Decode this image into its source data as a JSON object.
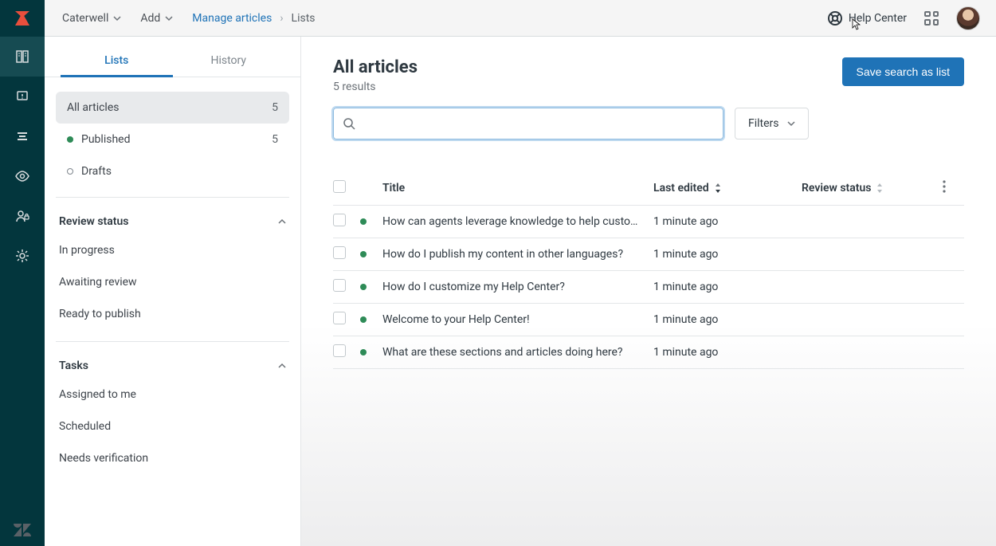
{
  "top": {
    "brand_dropdown": "Caterwell",
    "add": "Add",
    "breadcrumb_link": "Manage articles",
    "breadcrumb_current": "Lists",
    "help_center": "Help Center"
  },
  "sidebar": {
    "tabs": {
      "lists": "Lists",
      "history": "History"
    },
    "items": [
      {
        "label": "All articles",
        "count": "5"
      },
      {
        "label": "Published",
        "count": "5"
      },
      {
        "label": "Drafts",
        "count": ""
      }
    ],
    "review": {
      "title": "Review status",
      "items": [
        "In progress",
        "Awaiting review",
        "Ready to publish"
      ]
    },
    "tasks": {
      "title": "Tasks",
      "items": [
        "Assigned to me",
        "Scheduled",
        "Needs verification"
      ]
    }
  },
  "main": {
    "title": "All articles",
    "result_count": "5 results",
    "save_button": "Save search as list",
    "search_placeholder": "",
    "filters_label": "Filters",
    "columns": {
      "title": "Title",
      "last_edited": "Last edited",
      "review_status": "Review status"
    },
    "rows": [
      {
        "title": "How can agents leverage knowledge to help custo…",
        "edited": "1 minute ago"
      },
      {
        "title": "How do I publish my content in other languages?",
        "edited": "1 minute ago"
      },
      {
        "title": "How do I customize my Help Center?",
        "edited": "1 minute ago"
      },
      {
        "title": "Welcome to your Help Center!",
        "edited": "1 minute ago"
      },
      {
        "title": "What are these sections and articles doing here?",
        "edited": "1 minute ago"
      }
    ]
  }
}
